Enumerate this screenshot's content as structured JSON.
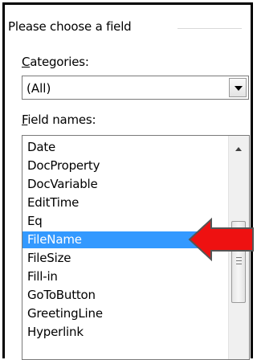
{
  "group": {
    "title": "Please choose a field"
  },
  "categories": {
    "label_accel": "C",
    "label_rest": "ategories:",
    "selected_value": "(All)"
  },
  "field_names": {
    "label_accel": "F",
    "label_rest": "ield names:",
    "items": [
      "Date",
      "DocProperty",
      "DocVariable",
      "EditTime",
      "Eq",
      "FileName",
      "FileSize",
      "Fill-in",
      "GoToButton",
      "GreetingLine",
      "Hyperlink"
    ],
    "selected": "FileName"
  },
  "icons": {
    "dropdown": "chevron-down-icon",
    "scroll_up": "scroll-up-arrow-icon",
    "callout": "red-arrow-pointer-icon"
  },
  "colors": {
    "selection": "#3399ff",
    "callout_arrow": "#ee1111"
  }
}
